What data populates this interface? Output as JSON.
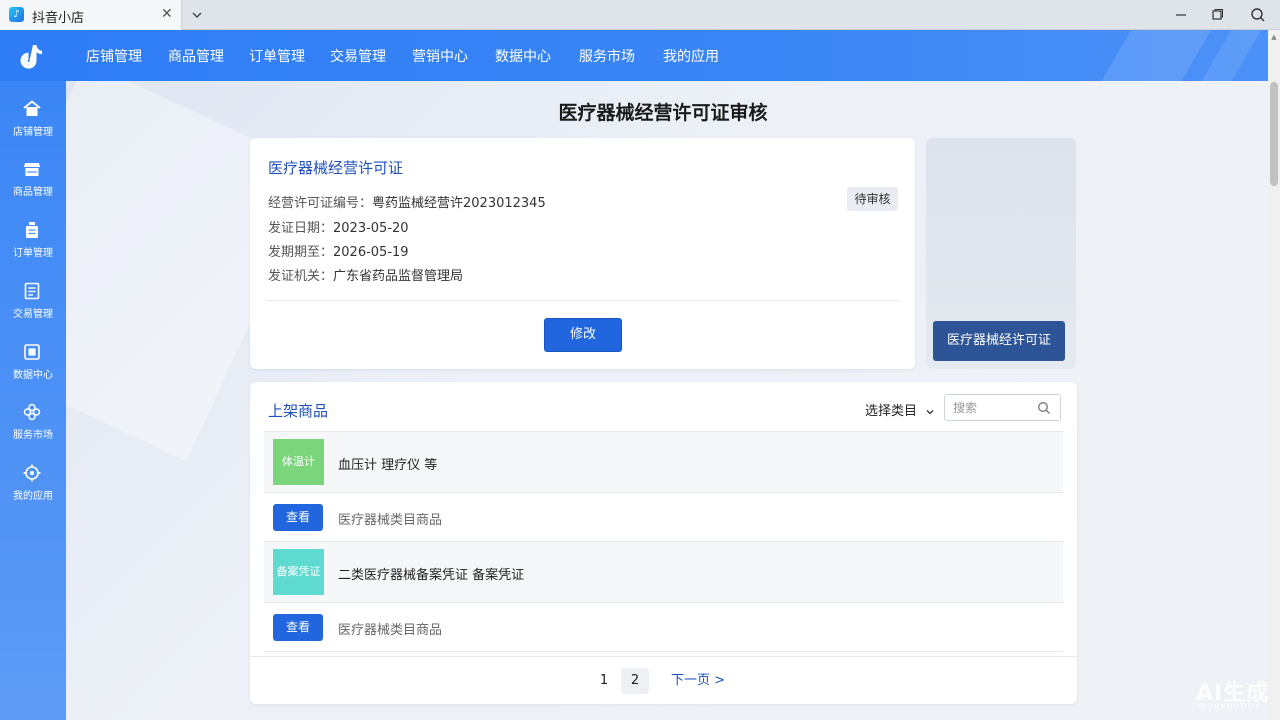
{
  "window": {
    "tab_title": "抖音小店",
    "tab_close": "✕"
  },
  "topnav": {
    "items": [
      "店铺管理",
      "商品管理",
      "订单管理",
      "交易管理",
      "营销中心",
      "数据中心",
      "服务市场",
      "我的应用"
    ]
  },
  "sidebar": {
    "items": [
      {
        "label": "店铺管理",
        "icon": "home-icon"
      },
      {
        "label": "商品管理",
        "icon": "store-icon"
      },
      {
        "label": "订单管理",
        "icon": "order-icon"
      },
      {
        "label": "交易管理",
        "icon": "transaction-icon"
      },
      {
        "label": "数据中心",
        "icon": "data-icon"
      },
      {
        "label": "服务市场",
        "icon": "service-icon"
      },
      {
        "label": "我的应用",
        "icon": "apps-icon"
      }
    ]
  },
  "page": {
    "title": "医疗器械经营许可证审核"
  },
  "license": {
    "card_title": "医疗器械经营许可证",
    "number_label": "经营许可证编号：",
    "number_value": "粤药监械经营许2023012345",
    "issue_label": "发证日期：",
    "issue_value": "2023-05-20",
    "expire_label": "发期期至：",
    "expire_value": "2026-05-19",
    "authority_label": "发证机关：",
    "authority_value": "广东省药品监督管理局",
    "status": "待审核",
    "edit_button": "修改"
  },
  "preview": {
    "button_label": "医疗器械经许可证"
  },
  "products": {
    "section_title": "上架商品",
    "category_select": "选择类目",
    "search_placeholder": "搜索",
    "rows": [
      {
        "thumb_text": "体温计",
        "thumb_color": "#7bd67b",
        "name": "血压计 理疗仪 等",
        "view_button": "查看",
        "desc": "医疗器械类目商品"
      },
      {
        "thumb_text": "备案凭证",
        "thumb_color": "#5fdad0",
        "name": "二类医疗器械备案凭证 备案凭证",
        "view_button": "查看",
        "desc": "医疗器械类目商品"
      }
    ]
  },
  "pagination": {
    "pages": [
      "1",
      "2"
    ],
    "current": "2",
    "next_label": "下一页 >"
  },
  "watermark": {
    "text": "AI生成",
    "sub": "WORKBUDDY"
  },
  "colors": {
    "brand_blue": "#2e7cf6",
    "button_blue": "#2166de",
    "link_blue": "#1d4fbf",
    "dark_button": "#2d5496"
  }
}
